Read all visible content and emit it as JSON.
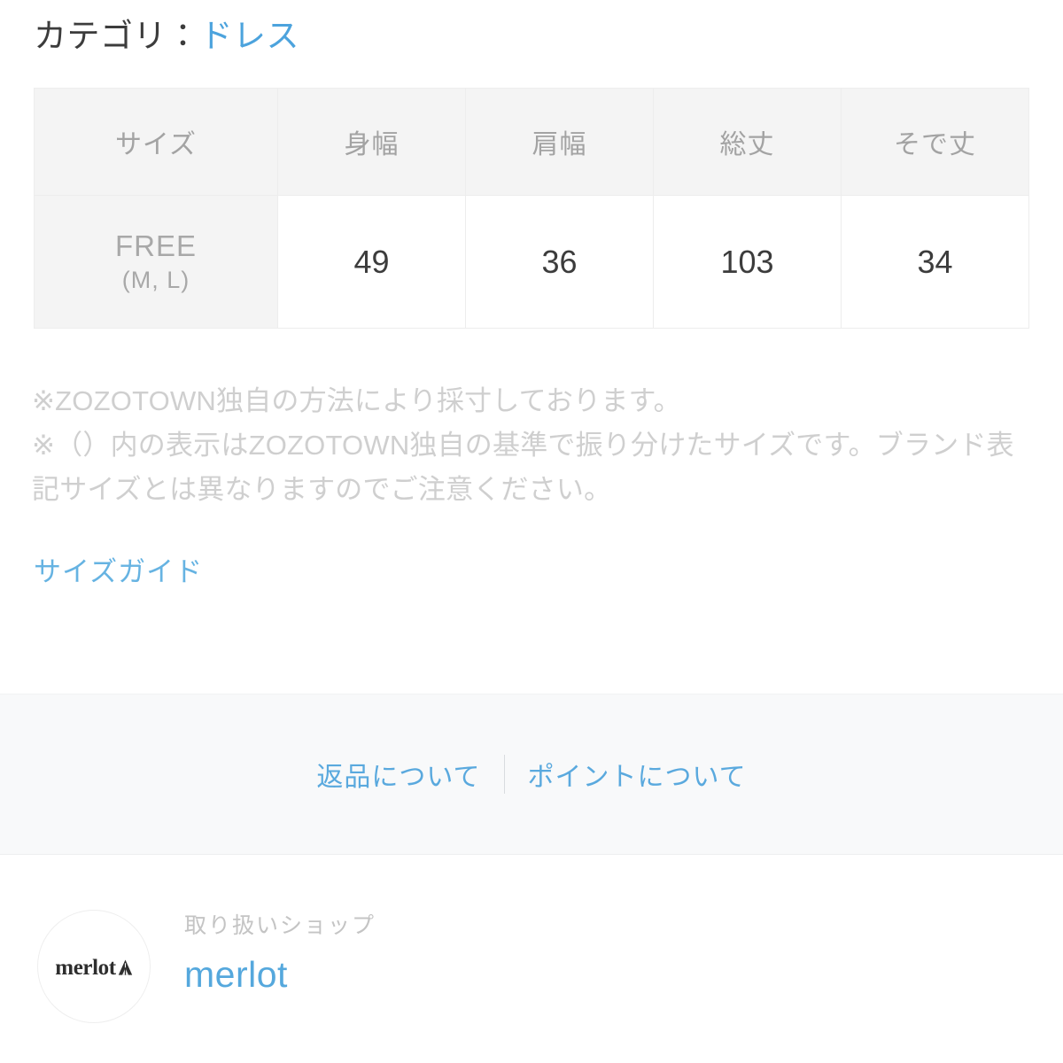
{
  "category": {
    "label": "カテゴリ：",
    "value": "ドレス"
  },
  "size_table": {
    "headers": [
      "サイズ",
      "身幅",
      "肩幅",
      "総丈",
      "そで丈"
    ],
    "rows": [
      {
        "size_main": "FREE",
        "size_sub": "(M, L)",
        "values": [
          "49",
          "36",
          "103",
          "34"
        ]
      }
    ]
  },
  "notes": [
    "※ZOZOTOWN独自の方法により採寸しております。",
    "※（）内の表示はZOZOTOWN独自の基準で振り分けたサイズです。ブランド表記サイズとは異なりますのでご注意ください。"
  ],
  "size_guide_link": "サイズガイド",
  "info_band": {
    "return_link": "返品について",
    "point_link": "ポイントについて"
  },
  "shop": {
    "kicker": "取り扱いショップ",
    "name": "merlot",
    "logo_text": "merlot"
  },
  "colors": {
    "link_blue": "#4ca3dd",
    "band_background": "#f8f9fa",
    "table_header_background": "#f4f4f4",
    "muted_text": "#a3a3a3",
    "note_text": "#cfcfcf"
  }
}
